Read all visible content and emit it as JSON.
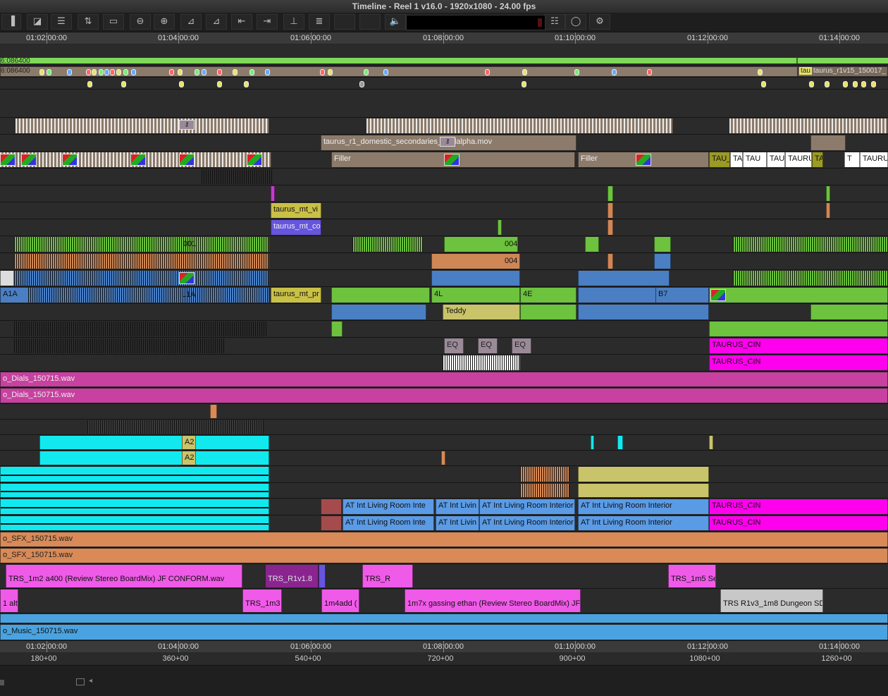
{
  "window": {
    "title": "Timeline - Reel 1 v16.0 - 1920x1080 - 24.00 fps"
  },
  "toolbar": {
    "buttons": [
      {
        "name": "toggle-source-record-button",
        "glyph": "▐"
      },
      {
        "name": "video-quality-button",
        "glyph": "◪"
      },
      {
        "name": "track-display-button",
        "glyph": "☰"
      },
      {
        "name": "track-settings-button",
        "glyph": "⇅"
      },
      {
        "name": "timeline-view-button",
        "glyph": "▭"
      },
      {
        "name": "zoom-out-button",
        "glyph": "⊖"
      },
      {
        "name": "zoom-in-button",
        "glyph": "⊕"
      },
      {
        "name": "lift-button",
        "glyph": "⊿"
      },
      {
        "name": "extract-button",
        "glyph": "⊿"
      },
      {
        "name": "overwrite-button",
        "glyph": "⇤"
      },
      {
        "name": "splice-in-button",
        "glyph": "⇥"
      },
      {
        "name": "add-edit-button",
        "glyph": "⊥"
      },
      {
        "name": "menu-button",
        "glyph": "≣"
      },
      {
        "name": "blank-button-1",
        "glyph": ""
      },
      {
        "name": "blank-button-2",
        "glyph": ""
      },
      {
        "name": "audio-button",
        "glyph": "🔈"
      },
      {
        "name": "list-button",
        "glyph": "☷"
      },
      {
        "name": "record-button",
        "glyph": "◯"
      },
      {
        "name": "settings-button",
        "glyph": "⚙"
      }
    ]
  },
  "ruler": {
    "labels": [
      "01:02:00:00",
      "01:04:00:00",
      "01:06:00:00",
      "01:08:00:00",
      "01:10:00:00",
      "01:12:00:00",
      "01:14:00:00"
    ]
  },
  "frame_ruler": {
    "labels": [
      "180+00",
      "360+00",
      "540+00",
      "720+00",
      "900+00",
      "1080+00",
      "1260+00"
    ]
  },
  "timecode_tracks": {
    "tc1": "6:086400",
    "tc2": "6:086400"
  },
  "clip_labels": {
    "domestic_secondaries": "taurus_r1_domestic_secondaries_avidalpha.mov",
    "filler_1": "Filler",
    "filler_2": "Filler",
    "tau_short": "TAU_",
    "tau_list": [
      "TA",
      "TAU",
      "TAU",
      "TAURUS",
      "TA",
      "T",
      "TAURU"
    ],
    "tc_clip": "tau",
    "tc_clip_name": "taurus_r1v15_150017_",
    "mt_v": "taurus_mt_vi",
    "mt_co": "taurus_mt_co",
    "mt_pr": "taurus_mt_pr",
    "v1_a": "A1A",
    "v1_b": "L1A",
    "v1_c": "B7",
    "v1_d": "4E",
    "v1_e": "4L",
    "v2_a": "001",
    "v2_b": "004",
    "v3_b": "004",
    "teddy": "Teddy",
    "dialog_1": "o_Dials_150715.wav",
    "dialog_2": "o_Dials_150715.wav",
    "sfx_1": "o_SFX_150715.wav",
    "sfx_2": "o_SFX_150715.wav",
    "music": "o_Music_150715.wav",
    "living_room": "AT Int Living Room Interior",
    "living_room_short": "AT Int Living Room Inte",
    "living_room_mid": "AT Int Livin",
    "trs_m2": "TRS_1m2 a400 (Review Stereo BoardMix) JF CONFORM.wav",
    "trs_r1": "TRS_R1v1.8",
    "trs_r": "TRS_R",
    "trs": "TRS",
    "trs_m5": "TRS_1m5 Se",
    "trs_m3": "TRS_1m3",
    "m4add": "1m4add (",
    "m7x": "1m7x gassing ethan (Review Stereo BoardMix) JF",
    "dungeon": "TRS R1v3_1m8 Dungeon SD",
    "alt": "1 alt",
    "taurus_cin": "TAURUS_CIN",
    "eq": "EQ",
    "a2": "A2"
  },
  "colors": {
    "green_bar": "#7ed957",
    "tan": "#8c7b6b",
    "video_green": "#6dc23e",
    "video_blue": "#4a7fc4",
    "video_orange": "#cf8756",
    "yellow": "#c9c46a",
    "magenta": "#ff00ee",
    "pink_audio": "#c840a0",
    "cyan": "#12e9ef",
    "orange_audio": "#d98a57",
    "blue_audio": "#5a9be6",
    "music_blue": "#4aa3e0",
    "purple": "#6655dd",
    "clip_pink": "#f05ae8",
    "clip_gray": "#c8c8c8"
  }
}
